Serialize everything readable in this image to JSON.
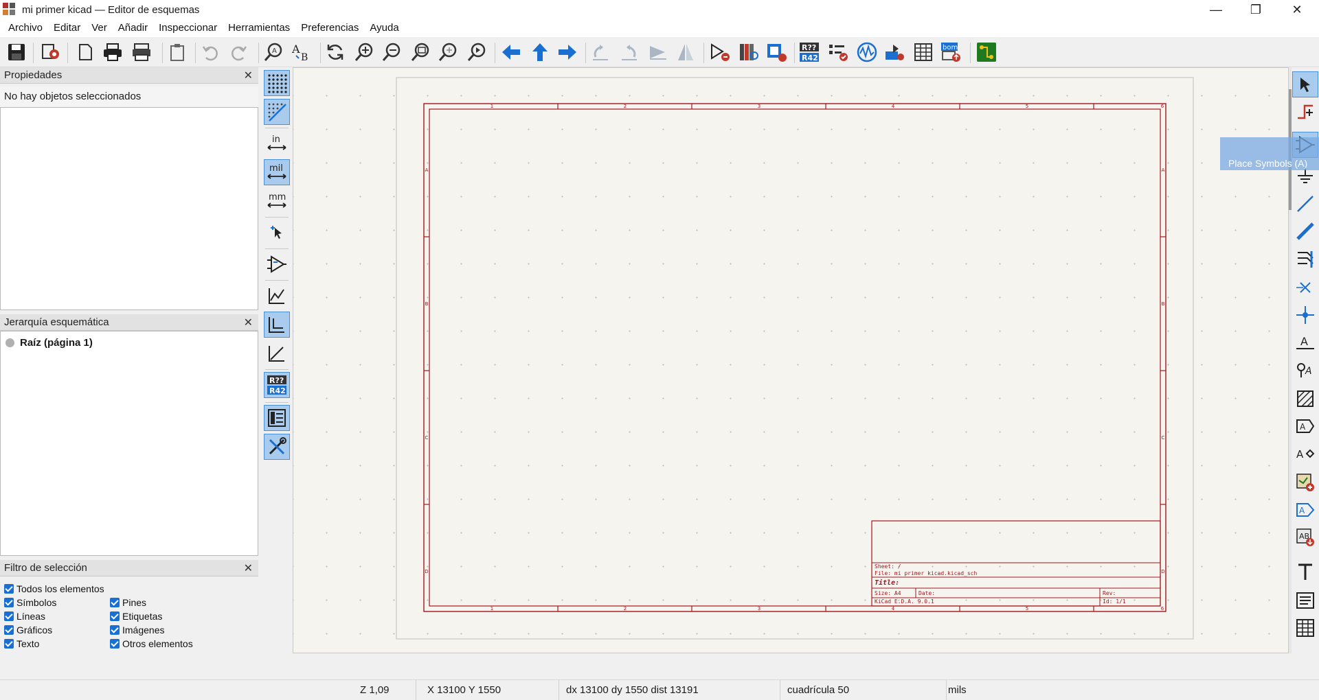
{
  "window": {
    "title": "mi primer kicad — Editor de esquemas",
    "minimize": "—",
    "restore": "❐",
    "close": "✕"
  },
  "menu": [
    "Archivo",
    "Editar",
    "Ver",
    "Añadir",
    "Inspeccionar",
    "Herramientas",
    "Preferencias",
    "Ayuda"
  ],
  "panels": {
    "properties": {
      "title": "Propiedades",
      "empty_text": "No hay objetos seleccionados",
      "close": "✕"
    },
    "hierarchy": {
      "title": "Jerarquía esquemática",
      "root": "Raíz (página 1)",
      "close": "✕"
    },
    "filter": {
      "title": "Filtro de selección",
      "close": "✕",
      "items": [
        "Todos los elementos",
        "Símbolos",
        "Líneas",
        "Gráficos",
        "Texto",
        "Pines",
        "Etiquetas",
        "Imágenes",
        "Otros elementos"
      ]
    }
  },
  "units": {
    "in": "in",
    "mil": "mil",
    "mm": "mm"
  },
  "sheet": {
    "cols": [
      "1",
      "2",
      "3",
      "4",
      "5",
      "6"
    ],
    "rows": [
      "A",
      "B",
      "C",
      "D"
    ],
    "tb_sheet": "Sheet: /",
    "tb_file": "File: mi primer kicad.kicad_sch",
    "tb_title": "Title:",
    "tb_size": "Size: A4",
    "tb_date": "Date:",
    "tb_rev": "Rev:",
    "tb_kicad": "KiCad E.D.A. 9.0.1",
    "tb_id": "Id: 1/1"
  },
  "tooltip": "Place Symbols  (A)",
  "status": {
    "zoom": "Z 1,09",
    "xy": "X 13100  Y 1550",
    "delta": "dx 13100  dy 1550  dist 13191",
    "grid": "cuadrícula 50",
    "units": "mils"
  },
  "colors": {
    "border_red": "#a3161e",
    "accent_blue": "#1a6fd0",
    "active_bg": "#a8cbee",
    "canvas_bg": "#f5f4ef"
  }
}
